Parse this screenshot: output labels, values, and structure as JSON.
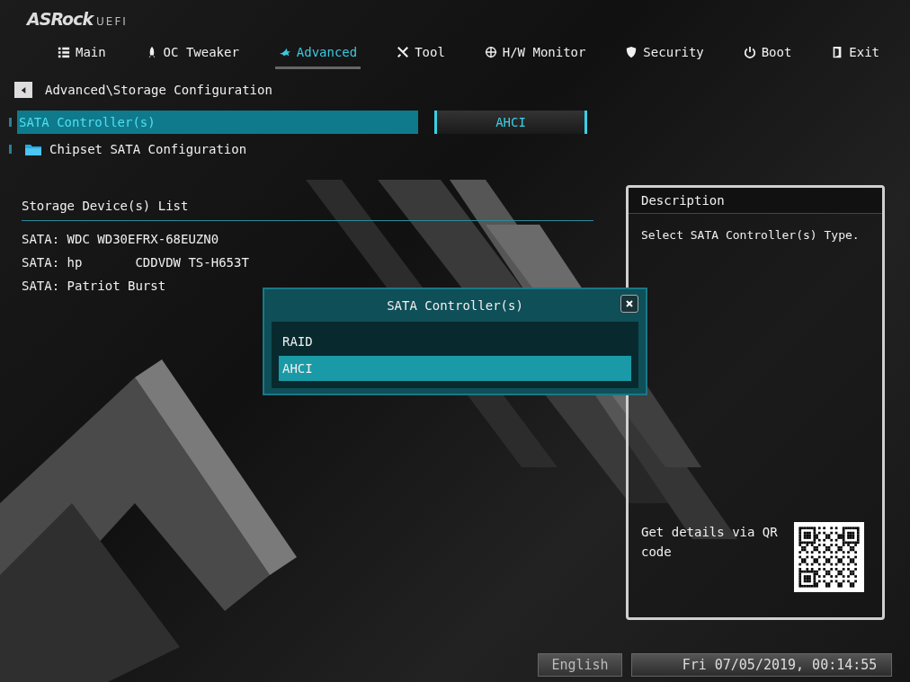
{
  "brand": {
    "logo": "ASRock",
    "suffix": "UEFI"
  },
  "tabs": [
    {
      "label": "Main",
      "selected": false
    },
    {
      "label": "OC Tweaker",
      "selected": false
    },
    {
      "label": "Advanced",
      "selected": true
    },
    {
      "label": "Tool",
      "selected": false
    },
    {
      "label": "H/W Monitor",
      "selected": false
    },
    {
      "label": "Security",
      "selected": false
    },
    {
      "label": "Boot",
      "selected": false
    },
    {
      "label": "Exit",
      "selected": false
    }
  ],
  "breadcrumb": "Advanced\\Storage Configuration",
  "settings": [
    {
      "kind": "option",
      "label": "SATA Controller(s)",
      "value": "AHCI",
      "selected": true
    },
    {
      "kind": "folder",
      "label": "Chipset SATA Configuration",
      "selected": false
    }
  ],
  "storage": {
    "title": "Storage Device(s) List",
    "devices": [
      "SATA: WDC WD30EFRX-68EUZN0",
      "SATA: hp       CDDVDW TS-H653T",
      "SATA: Patriot Burst"
    ]
  },
  "description": {
    "title": "Description",
    "text": "Select SATA Controller(s) Type.",
    "qr_text": "Get details via QR code"
  },
  "popup": {
    "title": "SATA Controller(s)",
    "options": [
      {
        "label": "RAID",
        "selected": false
      },
      {
        "label": "AHCI",
        "selected": true
      }
    ]
  },
  "footer": {
    "language": "English",
    "datetime": "Fri 07/05/2019, 00:14:55"
  }
}
